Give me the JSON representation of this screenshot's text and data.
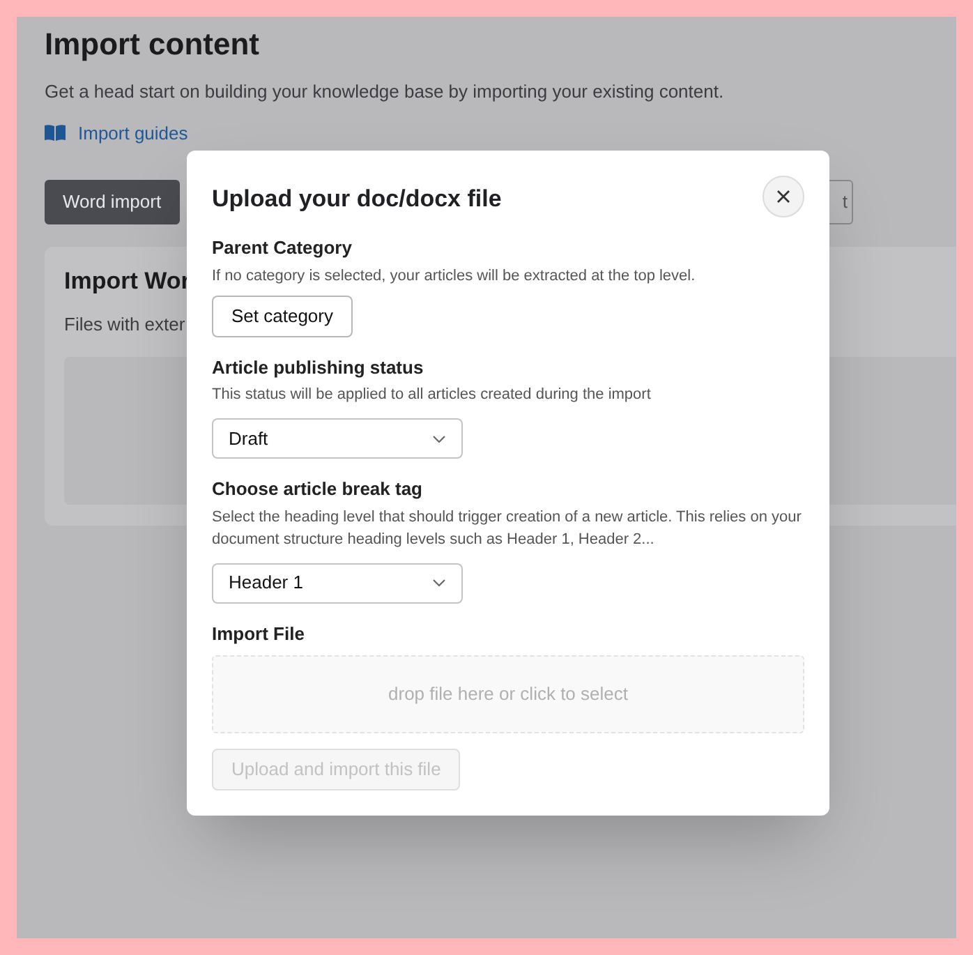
{
  "page": {
    "title": "Import content",
    "subtitle": "Get a head start on building your knowledge base by importing your existing content.",
    "guides_link": "Import guides",
    "tabs": [
      {
        "label": "Word import",
        "selected": true
      },
      {
        "label": "t",
        "selected": false
      }
    ],
    "card": {
      "title": "Import Wor",
      "description": "Files with exter"
    }
  },
  "dialog": {
    "title": "Upload your doc/docx file",
    "sections": [
      {
        "kind": "button",
        "label": "Parent Category",
        "help": "If no category is selected, your articles will be extracted at the top level.",
        "button": "Set category"
      },
      {
        "kind": "select",
        "label": "Article publishing status",
        "help": "This status will be applied to all articles created during the import",
        "value": "Draft"
      },
      {
        "kind": "select",
        "label": "Choose article break tag",
        "help": "Select the heading level that should trigger creation of a new article. This relies on your document structure heading levels such as Header 1, Header 2...",
        "value": "Header 1"
      },
      {
        "kind": "dropzone",
        "label": "Import File",
        "hint": "drop file here or click to select"
      }
    ],
    "submit": {
      "label": "Upload and import this file",
      "disabled": true
    }
  }
}
